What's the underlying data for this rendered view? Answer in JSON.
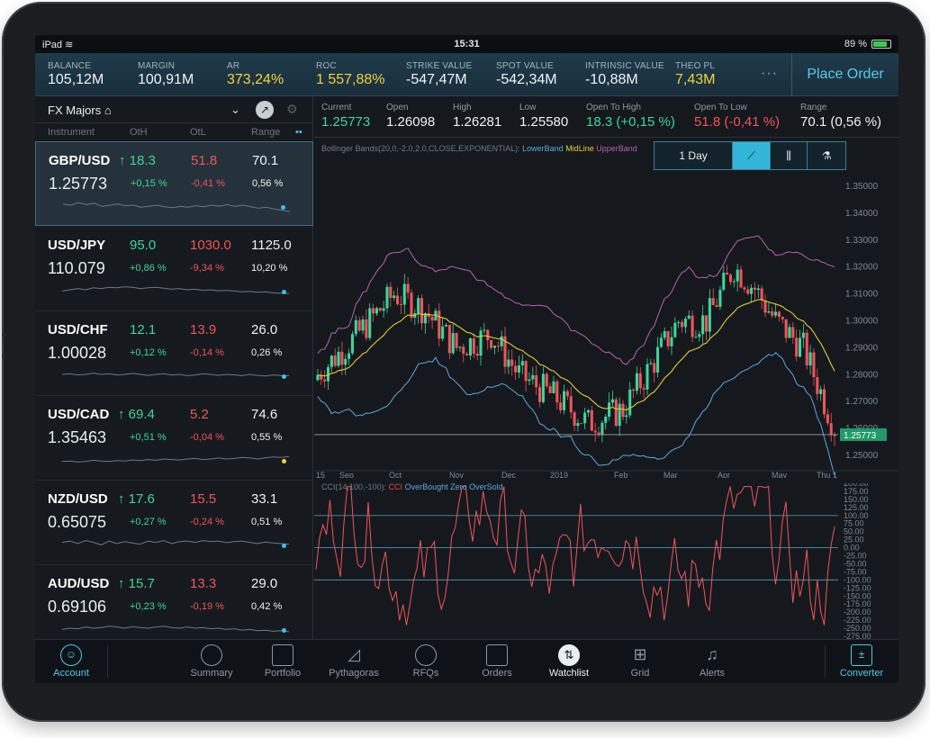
{
  "status_bar": {
    "device": "iPad",
    "time": "15:31",
    "battery": "89 %"
  },
  "metrics": [
    {
      "label": "BALANCE",
      "value": "105,12M",
      "highlight": false
    },
    {
      "label": "MARGIN",
      "value": "100,91M",
      "highlight": false
    },
    {
      "label": "AR",
      "value": "373,24%",
      "highlight": true
    },
    {
      "label": "ROC",
      "value": "1 557,88%",
      "highlight": true
    },
    {
      "label": "STRIKE VALUE",
      "value": "-547,47M",
      "highlight": false
    },
    {
      "label": "SPOT VALUE",
      "value": "-542,34M",
      "highlight": false
    },
    {
      "label": "INTRINSIC VALUE",
      "value": "-10,88M",
      "highlight": false
    },
    {
      "label": "THEO PL",
      "value": "7,43M",
      "highlight": true
    }
  ],
  "header": {
    "more": "···",
    "place_order": "Place Order"
  },
  "watchlist": {
    "title": "FX Majors",
    "columns": {
      "instrument": "Instrument",
      "oth": "OtH",
      "otl": "OtL",
      "range": "Range"
    },
    "rows": [
      {
        "symbol": "GBP/USD",
        "oth": "18.3",
        "otl": "51.8",
        "range": "70.1",
        "price": "1.25773",
        "oth_pct": "+0,15 %",
        "otl_pct": "-0,41 %",
        "range_pct": "0,56 %",
        "spark": [
          0.55,
          0.5,
          0.6,
          0.52,
          0.58,
          0.45,
          0.5,
          0.55,
          0.48,
          0.5,
          0.42,
          0.46,
          0.5,
          0.44,
          0.4,
          0.45,
          0.42,
          0.48,
          0.44,
          0.5,
          0.46,
          0.52,
          0.45,
          0.5,
          0.44,
          0.38,
          0.42,
          0.35,
          0.3,
          0.25
        ]
      },
      {
        "symbol": "USD/JPY",
        "oth": "95.0",
        "otl": "1030.0",
        "range": "1125.0",
        "price": "110.079",
        "oth_pct": "+0,86 %",
        "otl_pct": "-9,34 %",
        "range_pct": "10,20 %",
        "spark": [
          0.45,
          0.5,
          0.55,
          0.5,
          0.58,
          0.55,
          0.6,
          0.58,
          0.62,
          0.6,
          0.55,
          0.58,
          0.6,
          0.56,
          0.52,
          0.55,
          0.5,
          0.52,
          0.48,
          0.5,
          0.46,
          0.48,
          0.45,
          0.42,
          0.44,
          0.4,
          0.42,
          0.38,
          0.36,
          0.35
        ]
      },
      {
        "symbol": "USD/CHF",
        "oth": "12.1",
        "otl": "13.9",
        "range": "26.0",
        "price": "1.00028",
        "oth_pct": "+0,12 %",
        "otl_pct": "-0,14 %",
        "range_pct": "0,26 %",
        "spark": [
          0.5,
          0.52,
          0.48,
          0.5,
          0.55,
          0.5,
          0.52,
          0.48,
          0.5,
          0.54,
          0.5,
          0.46,
          0.5,
          0.52,
          0.48,
          0.5,
          0.45,
          0.48,
          0.52,
          0.5,
          0.46,
          0.5,
          0.48,
          0.45,
          0.5,
          0.46,
          0.44,
          0.48,
          0.45,
          0.45
        ]
      },
      {
        "symbol": "USD/CAD",
        "oth": "69.4",
        "otl": "5.2",
        "range": "74.6",
        "price": "1.35463",
        "oth_pct": "+0,51 %",
        "otl_pct": "-0,04 %",
        "range_pct": "0,55 %",
        "spark": [
          0.4,
          0.42,
          0.38,
          0.4,
          0.45,
          0.42,
          0.4,
          0.44,
          0.42,
          0.46,
          0.44,
          0.48,
          0.45,
          0.5,
          0.48,
          0.46,
          0.5,
          0.52,
          0.48,
          0.5,
          0.54,
          0.5,
          0.52,
          0.56,
          0.54,
          0.5,
          0.55,
          0.58,
          0.56,
          0.6
        ]
      },
      {
        "symbol": "NZD/USD",
        "oth": "17.6",
        "otl": "15.5",
        "range": "33.1",
        "price": "0.65075",
        "oth_pct": "+0,27 %",
        "otl_pct": "-0,24 %",
        "range_pct": "0,51 %",
        "spark": [
          0.55,
          0.6,
          0.5,
          0.62,
          0.55,
          0.45,
          0.6,
          0.5,
          0.58,
          0.52,
          0.48,
          0.6,
          0.55,
          0.62,
          0.5,
          0.58,
          0.6,
          0.55,
          0.62,
          0.58,
          0.6,
          0.54,
          0.58,
          0.6,
          0.55,
          0.5,
          0.56,
          0.52,
          0.5,
          0.48
        ]
      },
      {
        "symbol": "AUD/USD",
        "oth": "15.7",
        "otl": "13.3",
        "range": "29.0",
        "price": "0.69106",
        "oth_pct": "+0,23 %",
        "otl_pct": "-0,19 %",
        "range_pct": "0,42 %",
        "spark": [
          0.45,
          0.5,
          0.48,
          0.55,
          0.5,
          0.52,
          0.58,
          0.55,
          0.5,
          0.56,
          0.52,
          0.5,
          0.55,
          0.58,
          0.52,
          0.5,
          0.55,
          0.5,
          0.52,
          0.48,
          0.5,
          0.45,
          0.48,
          0.42,
          0.45,
          0.4,
          0.42,
          0.38,
          0.4,
          0.36
        ]
      }
    ]
  },
  "quote": {
    "current_label": "Current",
    "current": "1.25773",
    "open_label": "Open",
    "open": "1.26098",
    "high_label": "High",
    "high": "1.26281",
    "low_label": "Low",
    "low": "1.25580",
    "oth_label": "Open To High",
    "oth": "18.3 (+0,15 %)",
    "otl_label": "Open To Low",
    "otl": "51.8 (-0,41 %)",
    "range_label": "Range",
    "range": "70.1 (0,56 %)"
  },
  "indicator_label": {
    "prefix": "Bollinger Bands(20,0,-2.0,2.0,CLOSE,EXPONENTIAL):",
    "lower": "LowerBand",
    "mid": "MidLine",
    "upper": "UpperBand"
  },
  "toolbar": {
    "period": "1 Day"
  },
  "cci_label": {
    "prefix": "CCI(14,100,-100):",
    "c1": "CCI",
    "c2": "OverBought Zero OverSold"
  },
  "price_axis": [
    "1.35000",
    "1.34000",
    "1.33000",
    "1.32000",
    "1.31000",
    "1.30000",
    "1.29000",
    "1.28000",
    "1.27000",
    "1.26000",
    "1.25000"
  ],
  "current_price_tag": "1.25773",
  "time_axis": [
    "15",
    "Sep",
    "Oct",
    "Nov",
    "Dec",
    "2019",
    "Feb",
    "Mar",
    "Apr",
    "May",
    "Thu 1"
  ],
  "cci_axis": [
    "200.00",
    "175.00",
    "150.00",
    "125.00",
    "100.00",
    "75.00",
    "50.00",
    "25.00",
    "0.00",
    "-25.00",
    "-50.00",
    "-75.00",
    "-100.00",
    "-125.00",
    "-150.00",
    "-175.00",
    "-200.00",
    "-225.00",
    "-250.00",
    "-275.00"
  ],
  "colors": {
    "up": "#3ed59c",
    "down": "#f0545b",
    "accent": "#4ec8e8",
    "mid": "#e3cd2e",
    "upper": "#b562b0",
    "lower": "#5ea8df"
  },
  "tabs": [
    {
      "label": "Account",
      "icon": "person-icon"
    },
    {
      "label": "Summary",
      "icon": "gauge-icon"
    },
    {
      "label": "Portfolio",
      "icon": "briefcase-icon"
    },
    {
      "label": "Pythagoras",
      "icon": "triangle-icon"
    },
    {
      "label": "RFQs",
      "icon": "clock-icon"
    },
    {
      "label": "Orders",
      "icon": "document-icon"
    },
    {
      "label": "Watchlist",
      "icon": "updown-arrows-icon"
    },
    {
      "label": "Grid",
      "icon": "grid-icon"
    },
    {
      "label": "Alerts",
      "icon": "bell-icon"
    },
    {
      "label": "Converter",
      "icon": "calculator-icon"
    }
  ]
}
